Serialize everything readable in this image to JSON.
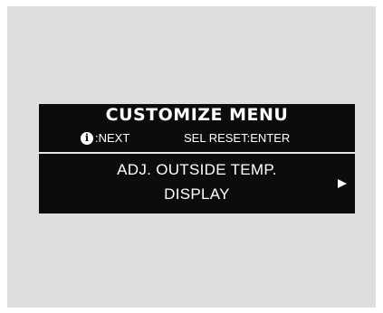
{
  "screen": {
    "title": "CUSTOMIZE MENU",
    "hints": {
      "info_icon_glyph": "i",
      "next_label": ":NEXT",
      "select_label": "SEL RESET:ENTER"
    },
    "menu_item": {
      "line1": "ADJ. OUTSIDE TEMP.",
      "line2": "DISPLAY"
    },
    "arrow_icon": "right-arrow-icon"
  },
  "colors": {
    "screen_bg": "#0c0c0c",
    "text": "#ffffff",
    "panel_bg": "#dedede"
  }
}
